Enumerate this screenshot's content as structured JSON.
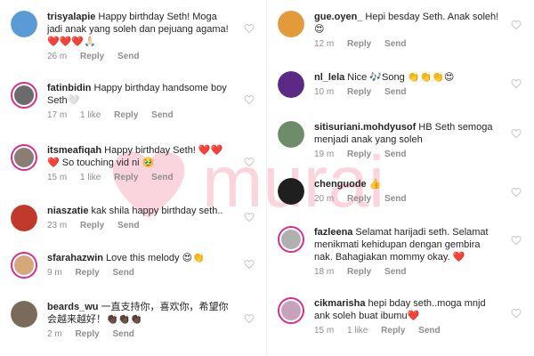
{
  "brand": {
    "watermark_text": "murai"
  },
  "colors": {
    "story_ring": "#d4308c",
    "meta_text": "#8e8e8e",
    "text": "#262626",
    "heart_outline": "#c7c7c7",
    "watermark": "#f36b8a"
  },
  "comments_left": [
    {
      "username": "trisyalapie",
      "text": "Happy birthday Seth! Moga jadi anak yang soleh dan pejuang agama! ❤️❤️❤️🙏🏻",
      "time": "26 m",
      "likes": "",
      "reply": "Reply",
      "send": "Send",
      "avatar_color": "#5b9bd5"
    },
    {
      "username": "fatinbidin",
      "text": "Happy birthday handsome boy Seth🤍",
      "time": "17 m",
      "likes": "1 like",
      "reply": "Reply",
      "send": "Send",
      "avatar_color": "#6b6b6b"
    },
    {
      "username": "itsmeafiqah",
      "text": "Happy birthday Seth! ❤️❤️❤️ So touching vid ni 🥹",
      "time": "15 m",
      "likes": "1 like",
      "reply": "Reply",
      "send": "Send",
      "avatar_color": "#8a7d74"
    },
    {
      "username": "niaszatie",
      "text": "kak shila happy birthday seth..",
      "time": "23 m",
      "likes": "",
      "reply": "Reply",
      "send": "Send",
      "avatar_color": "#c0392b"
    },
    {
      "username": "sfarahazwin",
      "text": "Love this melody 😍👏",
      "time": "9 m",
      "likes": "",
      "reply": "Reply",
      "send": "Send",
      "avatar_color": "#d6a77a"
    },
    {
      "username": "beards_wu",
      "text": "一直支持你，喜欢你，希望你会越来越好！👏🏿👏🏿👏🏿",
      "time": "2 m",
      "likes": "",
      "reply": "Reply",
      "send": "Send",
      "avatar_color": "#7a6a5c"
    }
  ],
  "comments_right": [
    {
      "username": "gue.oyen_",
      "text": "Hepi besday Seth. Anak soleh! 😍",
      "time": "12 m",
      "likes": "",
      "reply": "Reply",
      "send": "Send",
      "avatar_color": "#e39a3b"
    },
    {
      "username": "nl_lela",
      "text": "Nice 🎶Song 👏👏👏😍",
      "time": "10 m",
      "likes": "",
      "reply": "Reply",
      "send": "Send",
      "avatar_color": "#5b2a86"
    },
    {
      "username": "sitisuriani.mohdyusof",
      "text": "HB Seth semoga menjadi anak yang soleh",
      "time": "19 m",
      "likes": "",
      "reply": "Reply",
      "send": "Send",
      "avatar_color": "#6e8b6a"
    },
    {
      "username": "chenguode",
      "text": "👍",
      "time": "20 m",
      "likes": "",
      "reply": "Reply",
      "send": "Send",
      "avatar_color": "#1f1f1f"
    },
    {
      "username": "fazleena",
      "text": "Selamat harijadi seth. Selamat menikmati kehidupan dengan gembira nak. Bahagiakan mommy okay. ❤️",
      "time": "18 m",
      "likes": "",
      "reply": "Reply",
      "send": "Send",
      "avatar_color": "#b0b0b0"
    },
    {
      "username": "cikmarisha",
      "text": "hepi bday seth..moga mnjd ank soleh buat ibumu❤️",
      "time": "15 m",
      "likes": "1 like",
      "reply": "Reply",
      "send": "Send",
      "avatar_color": "#c7a2b8"
    }
  ]
}
